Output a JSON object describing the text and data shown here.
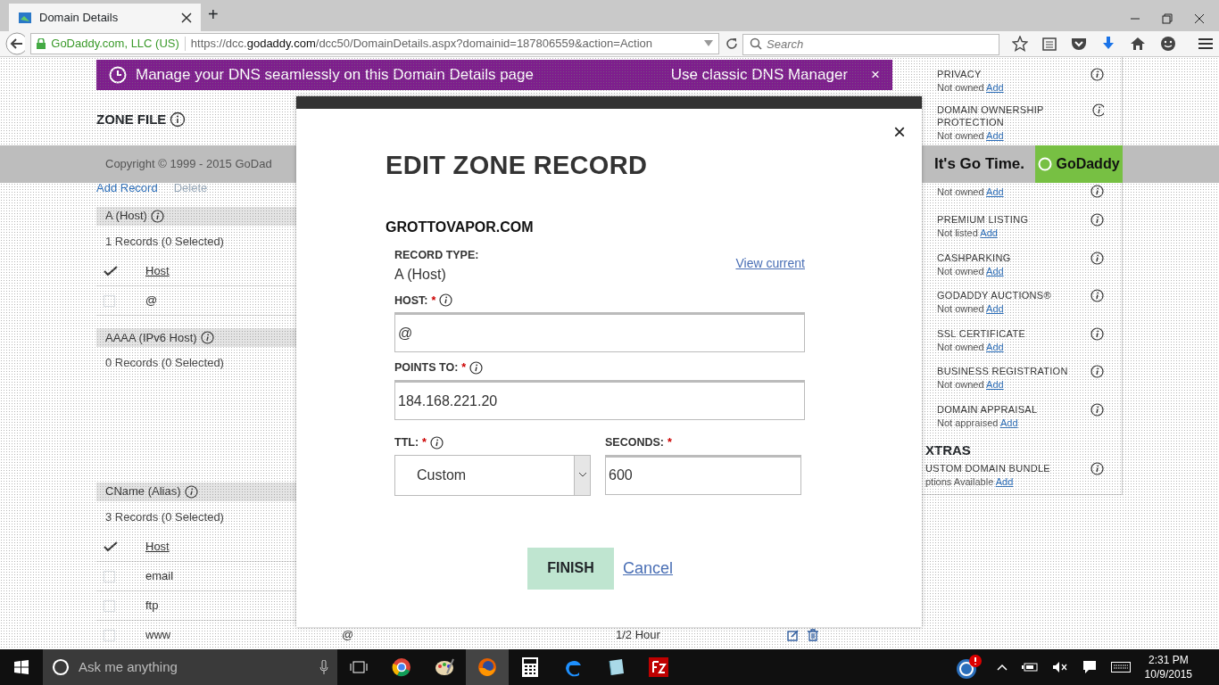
{
  "browser": {
    "tab_title": "Domain Details",
    "new_tab": "+",
    "identity": "GoDaddy.com, LLC (US)",
    "url": {
      "prefix": "https://dcc.",
      "domain": "godaddy.com",
      "rest": "/dcc50/DomainDetails.aspx?domainid=187806559&action=Action"
    },
    "search": {
      "placeholder": "Search"
    }
  },
  "page": {
    "banner": {
      "text": "Manage your DNS seamlessly on this Domain Details page",
      "link": "Use classic DNS Manager",
      "close": "×"
    },
    "zone_title": "ZONE FILE",
    "toolbar": [
      "Add Record",
      "Delete"
    ],
    "sections": [
      {
        "title": "A (Host)",
        "count": "1 Records (0 Selected)",
        "header": "Host",
        "rows": [
          {
            "host": "@",
            "checked": false
          }
        ]
      },
      {
        "title": "AAAA (IPv6 Host)",
        "count": "0 Records (0 Selected)"
      },
      {
        "title": "CName (Alias)",
        "count": "3 Records (0 Selected)",
        "header": "Host",
        "rows": [
          {
            "host": "email",
            "checked": false
          },
          {
            "host": "ftp",
            "checked": false
          },
          {
            "host": "www",
            "checked": false,
            "points_to": "@",
            "ttl": "1/2 Hour"
          }
        ]
      }
    ],
    "sidebar": [
      {
        "title": "PRIVACY",
        "status": "Not owned",
        "action": "Add"
      },
      {
        "title": "DOMAIN OWNERSHIP PROTECTION",
        "status": "Not owned",
        "action": "Add"
      },
      {
        "status": "Not owned",
        "action": "Add"
      },
      {
        "title": "PREMIUM LISTING",
        "status": "Not listed",
        "action": "Add"
      },
      {
        "title": "CASHPARKING",
        "status": "Not owned",
        "action": "Add"
      },
      {
        "title": "GODADDY AUCTIONS®",
        "status": "Not owned",
        "action": "Add"
      },
      {
        "title": "SSL CERTIFICATE",
        "status": "Not owned",
        "action": "Add"
      },
      {
        "title": "BUSINESS REGISTRATION",
        "status": "Not owned",
        "action": "Add"
      },
      {
        "title": "DOMAIN APPRAISAL",
        "status": "Not appraised",
        "action": "Add"
      }
    ],
    "extras_heading": "XTRAS",
    "extras": [
      {
        "title": "USTOM DOMAIN BUNDLE",
        "status": "ptions Available",
        "action": "Add"
      }
    ],
    "footer": {
      "copyright": "Copyright © 1999 - 2015 GoDad",
      "slogan": "It's Go Time.",
      "logo": "GoDaddy"
    }
  },
  "modal": {
    "close": "×",
    "title": "EDIT ZONE RECORD",
    "domain": "GROTTOVAPOR.COM",
    "record_type_label": "RECORD TYPE:",
    "record_type": "A (Host)",
    "view_current": "View current",
    "host": {
      "label": "HOST:",
      "required": "*",
      "value": "@"
    },
    "points_to": {
      "label": "POINTS TO:",
      "required": "*",
      "value": "184.168.221.20"
    },
    "ttl": {
      "label": "TTL:",
      "required": "*",
      "value": "Custom"
    },
    "seconds": {
      "label": "SECONDS:",
      "required": "*",
      "value": "600"
    },
    "finish": {
      "label": "FINISH",
      "disabled": true
    },
    "cancel": "Cancel"
  },
  "taskbar": {
    "search_placeholder": "Ask me anything",
    "time": "2:31 PM",
    "date": "10/9/2015"
  }
}
